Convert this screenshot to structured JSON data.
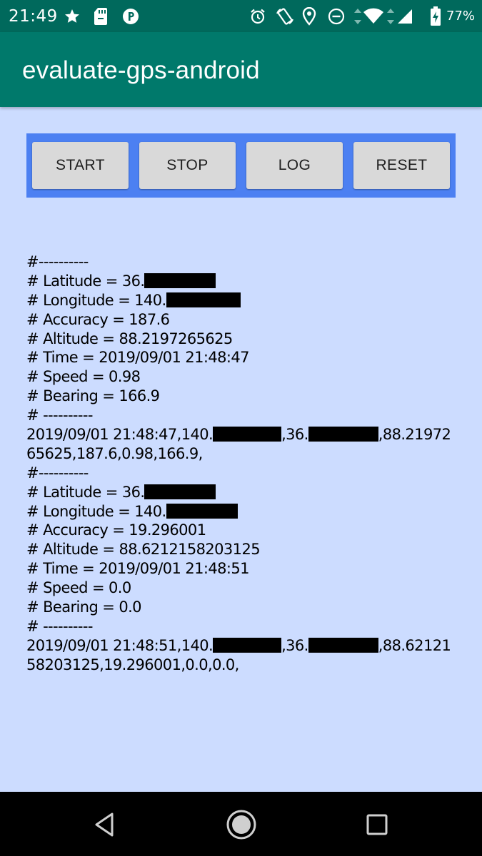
{
  "status_bar": {
    "time": "21:49",
    "battery_percent": "77%",
    "icons": [
      "star-icon",
      "sd-card-icon",
      "parking-icon",
      "alarm-icon",
      "rotate-icon",
      "location-icon",
      "do-not-disturb-icon",
      "data-arrows-icon",
      "wifi-icon",
      "signal-icon",
      "battery-charging-icon"
    ]
  },
  "app_bar": {
    "title": "evaluate-gps-android",
    "color": "#00796b"
  },
  "buttons": {
    "start": "START",
    "stop": "STOP",
    "log": "LOG",
    "reset": "RESET",
    "panel_color": "#4c80f2"
  },
  "log": {
    "entries": [
      {
        "separator_top": "#----------",
        "latitude_label": "# Latitude = 36.",
        "longitude_label": "# Longitude = 140.",
        "accuracy": "# Accuracy = 187.6",
        "altitude": "# Altitude = 88.2197265625",
        "time": "# Time = 2019/09/01 21:48:47",
        "speed": "# Speed = 0.98",
        "bearing": "# Bearing = 166.9",
        "separator_bottom": "# ----------",
        "csv_part1": "2019/09/01 21:48:47,140.",
        "csv_part2": ",36.",
        "csv_part3": ",88.21972",
        "csv_line2": "65625,187.6,0.98,166.9,"
      },
      {
        "separator_top": "#----------",
        "latitude_label": "# Latitude = 36.",
        "longitude_label": "# Longitude = 140.",
        "accuracy": "# Accuracy = 19.296001",
        "altitude": "# Altitude = 88.6212158203125",
        "time": "# Time = 2019/09/01 21:48:51",
        "speed": "# Speed = 0.0",
        "bearing": "# Bearing = 0.0",
        "separator_bottom": "# ----------",
        "csv_part1": "2019/09/01 21:48:51,140.",
        "csv_part2": ",36.",
        "csv_part3": ",88.62121",
        "csv_line2": "58203125,19.296001,0.0,0.0,"
      }
    ]
  },
  "nav_bar": {
    "back": "back-icon",
    "home": "home-icon",
    "recents": "recents-icon"
  }
}
